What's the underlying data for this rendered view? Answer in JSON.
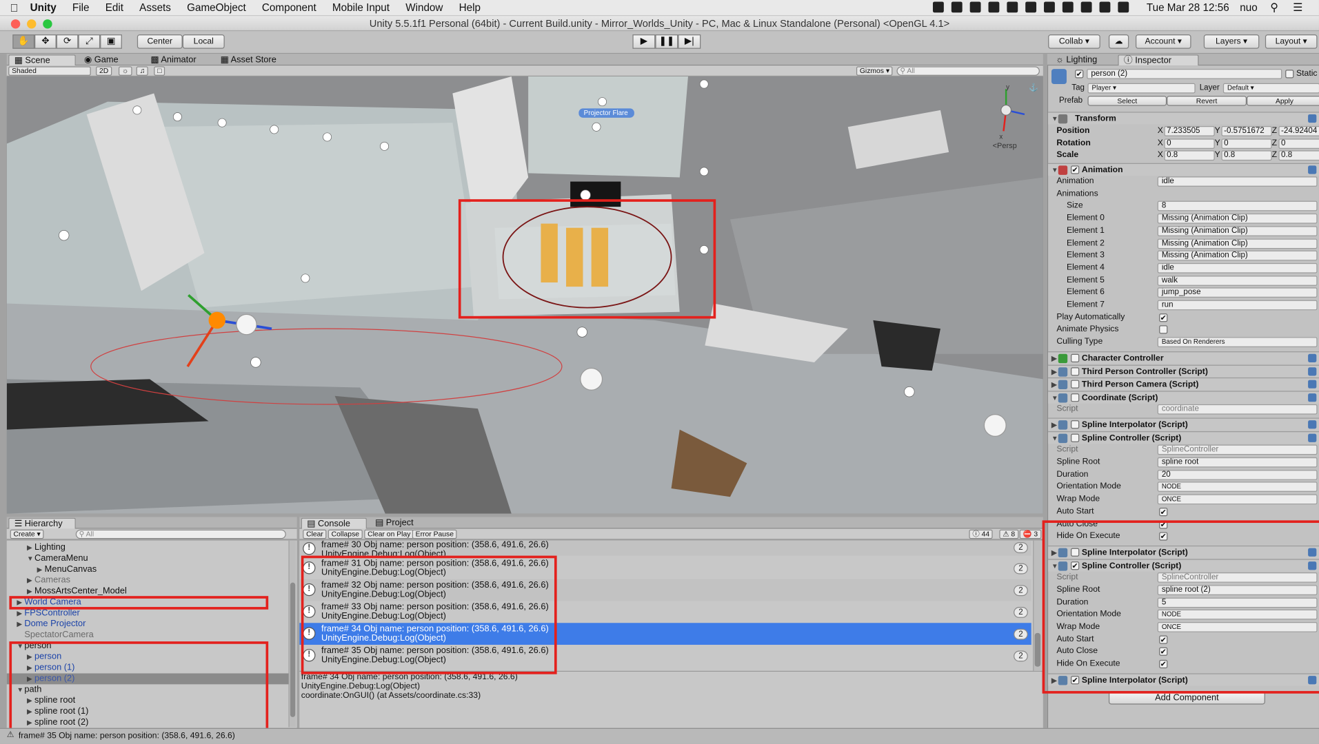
{
  "menubar": {
    "app": "Unity",
    "items": [
      "File",
      "Edit",
      "Assets",
      "GameObject",
      "Component",
      "Mobile Input",
      "Window",
      "Help"
    ],
    "clock": "Tue Mar 28  12:56",
    "user": "nuo"
  },
  "window": {
    "title": "Unity 5.5.1f1 Personal (64bit) - Current Build.unity - Mirror_Worlds_Unity - PC, Mac & Linux Standalone (Personal) <OpenGL 4.1>"
  },
  "toolbar": {
    "center": "Center",
    "local": "Local",
    "collab": "Collab",
    "account": "Account",
    "layers": "Layers",
    "layout": "Layout"
  },
  "scene_tabs": {
    "scene": "Scene",
    "game": "Game",
    "animator": "Animator",
    "asset_store": "Asset Store",
    "shaded": "Shaded",
    "mode2d": "2D",
    "gizmos": "Gizmos",
    "search_placeholder": "All"
  },
  "scene": {
    "label_projector": "Projector Flare",
    "persp": "Persp",
    "axis_y": "y",
    "axis_x": "x"
  },
  "hierarchy": {
    "tab": "Hierarchy",
    "create": "Create",
    "search_placeholder": "All",
    "items": [
      {
        "label": "Lighting",
        "indent": 2,
        "arrow": "▶",
        "style": ""
      },
      {
        "label": "CameraMenu",
        "indent": 2,
        "arrow": "▼",
        "style": ""
      },
      {
        "label": "MenuCanvas",
        "indent": 3,
        "arrow": "▶",
        "style": ""
      },
      {
        "label": "Cameras",
        "indent": 2,
        "arrow": "▶",
        "style": "grey"
      },
      {
        "label": "MossArtsCenter_Model",
        "indent": 2,
        "arrow": "▶",
        "style": ""
      },
      {
        "label": "World Camera",
        "indent": 1,
        "arrow": "▶",
        "style": "blue"
      },
      {
        "label": "FPSController",
        "indent": 1,
        "arrow": "▶",
        "style": "blue"
      },
      {
        "label": "Dome Projector",
        "indent": 1,
        "arrow": "▶",
        "style": "blue"
      },
      {
        "label": "SpectatorCamera",
        "indent": 1,
        "arrow": "",
        "style": "grey"
      },
      {
        "label": "person",
        "indent": 1,
        "arrow": "▼",
        "style": ""
      },
      {
        "label": "person",
        "indent": 2,
        "arrow": "▶",
        "style": "blue"
      },
      {
        "label": "person (1)",
        "indent": 2,
        "arrow": "▶",
        "style": "blue"
      },
      {
        "label": "person (2)",
        "indent": 2,
        "arrow": "▶",
        "style": "sel"
      },
      {
        "label": "path",
        "indent": 1,
        "arrow": "▼",
        "style": ""
      },
      {
        "label": "spline root",
        "indent": 2,
        "arrow": "▶",
        "style": ""
      },
      {
        "label": "spline root (1)",
        "indent": 2,
        "arrow": "▶",
        "style": ""
      },
      {
        "label": "spline root (2)",
        "indent": 2,
        "arrow": "▶",
        "style": ""
      }
    ]
  },
  "console": {
    "tab": "Console",
    "project_tab": "Project",
    "buttons": [
      "Clear",
      "Collapse",
      "Clear on Play",
      "Error Pause"
    ],
    "count_info": "44",
    "count_warn": "8",
    "count_err": "3",
    "partial_row": "frame# 30 Obj name: person position: (358.6, 491.6, 26.6)",
    "partial_row2": "UnityEngine.Debug:Log(Object)",
    "rows": [
      {
        "line1": "frame# 31 Obj name: person position: (358.6, 491.6, 26.6)",
        "line2": "UnityEngine.Debug:Log(Object)",
        "count": "2"
      },
      {
        "line1": "frame# 32 Obj name: person position: (358.6, 491.6, 26.6)",
        "line2": "UnityEngine.Debug:Log(Object)",
        "count": "2"
      },
      {
        "line1": "frame# 33 Obj name: person position: (358.6, 491.6, 26.6)",
        "line2": "UnityEngine.Debug:Log(Object)",
        "count": "2"
      },
      {
        "line1": "frame# 34 Obj name: person position: (358.6, 491.6, 26.6)",
        "line2": "UnityEngine.Debug:Log(Object)",
        "count": "2"
      },
      {
        "line1": "frame# 35 Obj name: person position: (358.6, 491.6, 26.6)",
        "line2": "UnityEngine.Debug:Log(Object)",
        "count": "2"
      }
    ],
    "detail": [
      "frame# 34 Obj name: person position: (358.6, 491.6, 26.6)",
      "UnityEngine.Debug:Log(Object)",
      "coordinate:OnGUI() (at Assets/coordinate.cs:33)"
    ]
  },
  "status": {
    "text": "frame# 35 Obj name: person position: (358.6, 491.6, 26.6)"
  },
  "inspector": {
    "lighting_tab": "Lighting",
    "inspector_tab": "Inspector",
    "object_name": "person (2)",
    "static": "Static",
    "tag_label": "Tag",
    "tag": "Player",
    "layer_label": "Layer",
    "layer": "Default",
    "prefab_label": "Prefab",
    "prefab_select": "Select",
    "prefab_revert": "Revert",
    "prefab_apply": "Apply",
    "transform": {
      "title": "Transform",
      "position": [
        "7.233505",
        "-0.5751672",
        "-24.92404"
      ],
      "rotation": [
        "0",
        "0",
        "0"
      ],
      "scale": [
        "0.8",
        "0.8",
        "0.8"
      ],
      "position_label": "Position",
      "rotation_label": "Rotation",
      "scale_label": "Scale"
    },
    "animation": {
      "title": "Animation",
      "animation_label": "Animation",
      "animation_value": "idle",
      "animations_label": "Animations",
      "size_label": "Size",
      "size": "8",
      "elements": [
        [
          "Element 0",
          "Missing (Animation Clip)"
        ],
        [
          "Element 1",
          "Missing (Animation Clip)"
        ],
        [
          "Element 2",
          "Missing (Animation Clip)"
        ],
        [
          "Element 3",
          "Missing (Animation Clip)"
        ],
        [
          "Element 4",
          "idle"
        ],
        [
          "Element 5",
          "walk"
        ],
        [
          "Element 6",
          "jump_pose"
        ],
        [
          "Element 7",
          "run"
        ]
      ],
      "play_auto": "Play Automatically",
      "animate_physics": "Animate Physics",
      "culling_label": "Culling Type",
      "culling": "Based On Renderers"
    },
    "char_controller": "Character Controller",
    "tpc": "Third Person Controller (Script)",
    "tpcam": "Third Person Camera (Script)",
    "coord": "Coordinate (Script)",
    "coord_script_label": "Script",
    "coord_script": "coordinate",
    "spline_interp": "Spline Interpolator (Script)",
    "spline_ctrl": "Spline Controller (Script)",
    "sc1": {
      "script": "SplineController",
      "root": "spline root",
      "duration": "20",
      "orientation": "NODE",
      "wrap": "ONCE"
    },
    "sc2": {
      "script": "SplineController",
      "root": "spline root (2)",
      "duration": "5",
      "orientation": "NODE",
      "wrap": "ONCE"
    },
    "labels": {
      "script": "Script",
      "root": "Spline Root",
      "duration": "Duration",
      "orientation": "Orientation Mode",
      "wrap": "Wrap Mode",
      "auto_start": "Auto Start",
      "auto_close": "Auto Close",
      "hide": "Hide On Execute"
    },
    "add_component": "Add Component"
  },
  "xyz": {
    "x": "X",
    "y": "Y",
    "z": "Z"
  },
  "check": "✔",
  "colors": {
    "highlight": "#e3211d",
    "selection": "#3e7ce8"
  }
}
